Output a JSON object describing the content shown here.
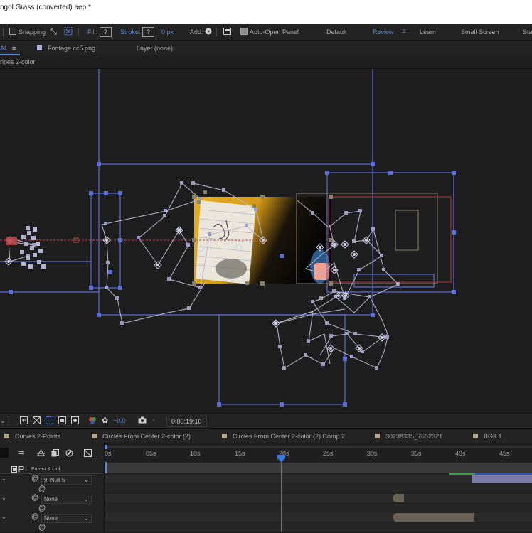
{
  "window": {
    "title": "ngol Grass (converted).aep *"
  },
  "toolbar": {
    "snapping_label": "Snapping",
    "fill_label": "Fill:",
    "fill_value": "?",
    "stroke_label": "Stroke:",
    "stroke_value": "?",
    "stroke_width": "0 px",
    "add_label": "Add:",
    "auto_open_label": "Auto-Open Panel",
    "workspaces": [
      "Default",
      "Review",
      "Learn",
      "Small Screen",
      "Sta"
    ],
    "active_workspace": "Review",
    "active_color": "#5b8ad8"
  },
  "panels": {
    "comp_tab": "AL",
    "footage_tab": "Footage cc5.png",
    "layer_tab": "Layer (none)",
    "breadcrumb": "ripes 2-color"
  },
  "viewer_controls": {
    "exposure": "+0.0",
    "timecode": "0:00:19:10"
  },
  "comp_tabs": [
    "Curves 2-Points",
    "Circles From Center 2-color (2)",
    "Circles From Center 2-color (2) Comp 2",
    "30238335_7652321",
    "BG3 1"
  ],
  "timeline": {
    "ruler_ticks": [
      "0s",
      "05s",
      "10s",
      "15s",
      "20s",
      "25s",
      "30s",
      "35s",
      "40s",
      "45s"
    ],
    "parent_link_header": "Parent & Link",
    "layers": [
      {
        "parent": "9. Null 5"
      },
      {
        "parent": "None"
      },
      {
        "parent": "None"
      }
    ]
  }
}
